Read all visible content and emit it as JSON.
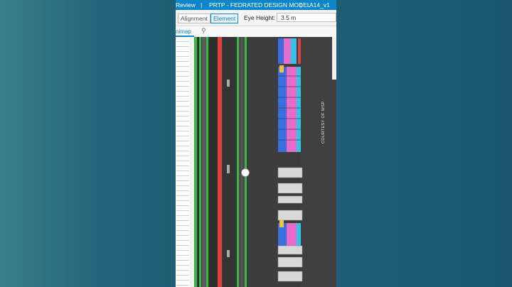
{
  "title_bar": {
    "left": "Review",
    "separator": "|",
    "model_name": "PRTP - FEDRATED DESIGN MODEL",
    "view_name": "A14_v1"
  },
  "toolbar": {
    "segments": [
      {
        "label": "Alignment",
        "selected": false
      },
      {
        "label": "Element",
        "selected": true
      }
    ],
    "eye_height_label": "Eye Height:",
    "eye_height_value": "3.5 m"
  },
  "tabs": {
    "minimap_label": "nimap",
    "second_icon": "translate-icon"
  },
  "map": {
    "watermark": "COURTESY OF WSP",
    "colors": {
      "background": "#3a3a3a",
      "green": "#39b54a",
      "red": "#e0413c",
      "pink": "#e86bc8",
      "blue": "#3a6fe0",
      "cyan": "#35c2e8",
      "gray_block": "#d8d8d8"
    }
  },
  "colors": {
    "accent": "#0d86c9",
    "title_text": "#ffffff"
  }
}
